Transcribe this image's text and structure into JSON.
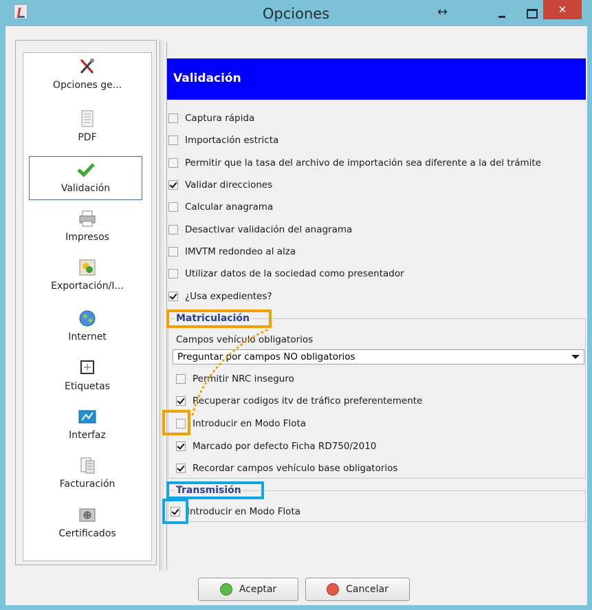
{
  "window": {
    "title": "Opciones",
    "close_label": "✕"
  },
  "sidebar": {
    "items": [
      {
        "label": "Opciones ge...",
        "icon": "tools-icon"
      },
      {
        "label": "PDF",
        "icon": "document-icon"
      },
      {
        "label": "Validación",
        "icon": "checkmark-icon",
        "selected": true
      },
      {
        "label": "Impresos",
        "icon": "printer-icon"
      },
      {
        "label": "Exportación/I...",
        "icon": "export-icon"
      },
      {
        "label": "Internet",
        "icon": "globe-icon"
      },
      {
        "label": "Etiquetas",
        "icon": "label-icon"
      },
      {
        "label": "Interfaz",
        "icon": "interface-icon"
      },
      {
        "label": "Facturación",
        "icon": "invoice-icon"
      },
      {
        "label": "Certificados",
        "icon": "certificate-icon"
      }
    ]
  },
  "main": {
    "header": "Validación",
    "options": [
      {
        "label": "Captura rápida",
        "checked": false
      },
      {
        "label": "Importación estricta",
        "checked": false
      },
      {
        "label": "Permitir que la tasa del archivo de importación sea diferente a la del trámite",
        "checked": false
      },
      {
        "label": "Validar direcciones",
        "checked": true
      },
      {
        "label": "Calcular anagrama",
        "checked": false
      },
      {
        "label": "Desactivar validación del anagrama",
        "checked": false
      },
      {
        "label": "IMVTM redondeo al alza",
        "checked": false
      },
      {
        "label": "Utilizar datos de la sociedad como presentador",
        "checked": false
      },
      {
        "label": "¿Usa expedientes?",
        "checked": true
      }
    ],
    "matriculacion": {
      "title": "Matriculación",
      "campos_label": "Campos vehículo obligatorios",
      "select_value": "Preguntar por campos NO obligatorios",
      "options": [
        {
          "label": "Permitir NRC inseguro",
          "checked": false
        },
        {
          "label": "Recuperar codigos itv de tráfico preferentemente",
          "checked": true
        },
        {
          "label": "Introducir en Modo Flota",
          "checked": false
        },
        {
          "label": "Marcado por defecto Ficha RD750/2010",
          "checked": true
        },
        {
          "label": "Recordar campos vehículo base obligatorios",
          "checked": true
        }
      ]
    },
    "transmision": {
      "title": "Transmisión",
      "options": [
        {
          "label": "Introducir en Modo Flota",
          "checked": true
        }
      ]
    }
  },
  "buttons": {
    "accept": "Aceptar",
    "cancel": "Cancelar"
  },
  "colors": {
    "header_bg": "#0000ff",
    "highlight_orange": "#f0a000",
    "highlight_blue": "#14a5e5",
    "titlebar": "#7dc1d6",
    "close": "#c9453a"
  }
}
